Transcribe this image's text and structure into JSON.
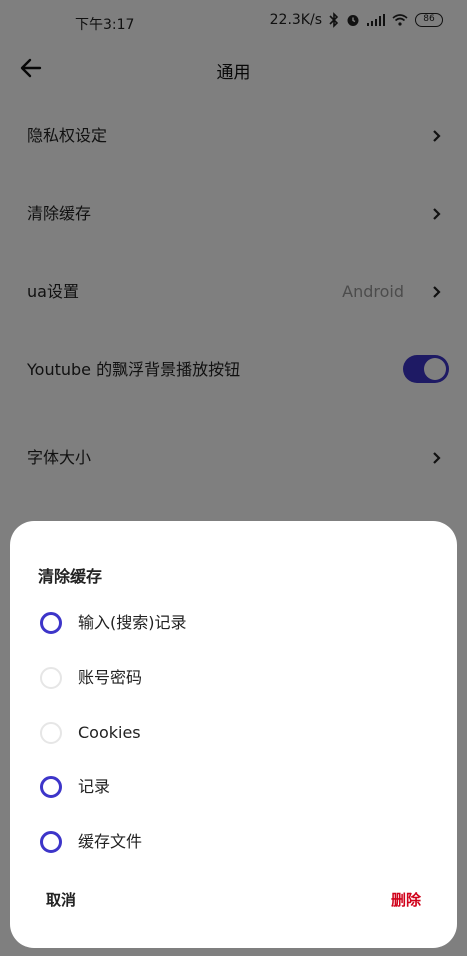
{
  "status_bar": {
    "time": "下午3:17",
    "network_speed": "22.3K/s",
    "battery": "86",
    "icons": [
      "bluetooth-icon",
      "alarm-icon",
      "signal-icon",
      "wifi-icon",
      "battery-icon"
    ]
  },
  "header": {
    "title": "通用",
    "back_icon": "arrow-left-icon"
  },
  "settings": {
    "items": [
      {
        "label": "隐私权设定",
        "value": "",
        "control": "chevron"
      },
      {
        "label": "清除缓存",
        "value": "",
        "control": "chevron"
      },
      {
        "label": "ua设置",
        "value": "Android",
        "control": "chevron"
      },
      {
        "label": "Youtube 的飘浮背景播放按钮",
        "value": "",
        "control": "toggle",
        "toggle_on": true
      },
      {
        "label": "字体大小",
        "value": "",
        "control": "chevron"
      }
    ]
  },
  "dialog": {
    "title": "清除缓存",
    "options": [
      {
        "label": "输入(搜索)记录",
        "checked": true
      },
      {
        "label": "账号密码",
        "checked": false
      },
      {
        "label": "Cookies",
        "checked": false
      },
      {
        "label": "记录",
        "checked": true
      },
      {
        "label": "缓存文件",
        "checked": true
      }
    ],
    "cancel_label": "取消",
    "delete_label": "删除"
  },
  "colors": {
    "accent": "#3d35c9",
    "danger": "#d0021b",
    "scrim": "rgba(0,0,0,0.5)"
  }
}
